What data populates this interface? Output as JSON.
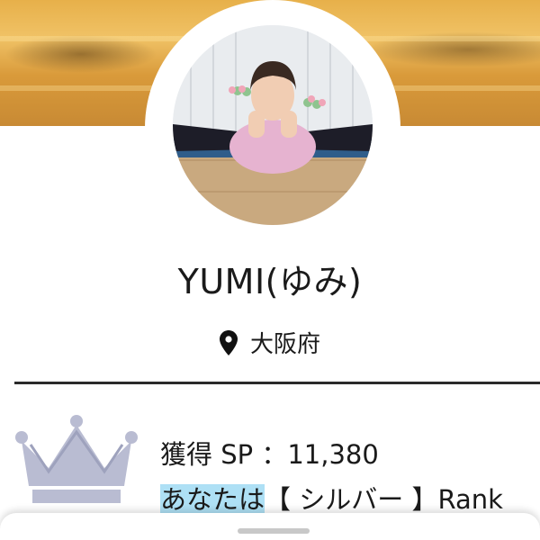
{
  "profile": {
    "name": "YUMI(ゆみ)",
    "location": "大阪府"
  },
  "stats": {
    "sp_label": "獲得 SP ：",
    "sp_value": "11,380",
    "rank_prefix": "あなたは",
    "rank_name": "【 シルバー 】",
    "rank_suffix": "Rank"
  },
  "icons": {
    "location": "location-pin-icon",
    "rank": "crown-icon"
  },
  "colors": {
    "rank_highlight": "#aee0f5",
    "crown": "#b9bcd2"
  }
}
